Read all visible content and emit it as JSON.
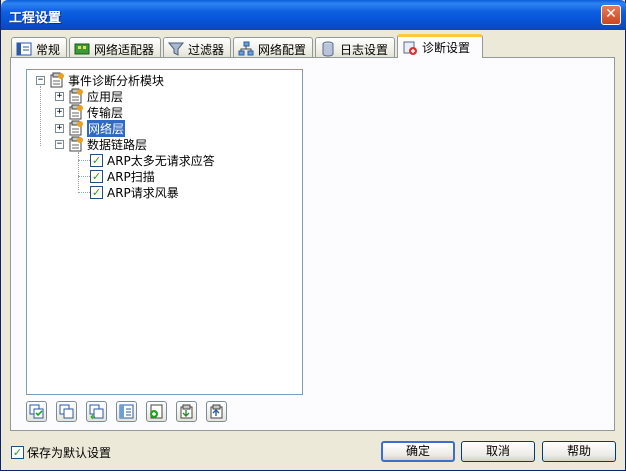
{
  "window": {
    "title": "工程设置",
    "close_glyph": "✕"
  },
  "tabs": [
    {
      "label": "常规",
      "icon": "general-icon"
    },
    {
      "label": "网络适配器",
      "icon": "network-adapter-icon"
    },
    {
      "label": "过滤器",
      "icon": "filter-icon"
    },
    {
      "label": "网络配置",
      "icon": "network-config-icon"
    },
    {
      "label": "日志设置",
      "icon": "log-icon"
    },
    {
      "label": "诊断设置",
      "icon": "diagnosis-icon",
      "active": true
    }
  ],
  "tree": {
    "root": {
      "label": "事件诊断分析模块",
      "expander": "−"
    },
    "children": [
      {
        "label": "应用层",
        "expander": "+"
      },
      {
        "label": "传输层",
        "expander": "+"
      },
      {
        "label": "网络层",
        "expander": "+",
        "selected": true
      },
      {
        "label": "数据链路层",
        "expander": "−",
        "children": [
          {
            "label": "ARP太多无请求应答",
            "checked": true
          },
          {
            "label": "ARP扫描",
            "checked": true
          },
          {
            "label": "ARP请求风暴",
            "checked": true
          }
        ]
      }
    ]
  },
  "toolbar": [
    "check-all-icon",
    "uncheck-all-icon",
    "invert-check-icon",
    "properties-icon",
    "add-icon",
    "import-icon",
    "export-icon"
  ],
  "footer": {
    "save_default_label": "保存为默认设置",
    "save_default_checked": true,
    "ok_label": "确定",
    "cancel_label": "取消",
    "help_label": "帮助"
  },
  "check_glyph": "✓"
}
